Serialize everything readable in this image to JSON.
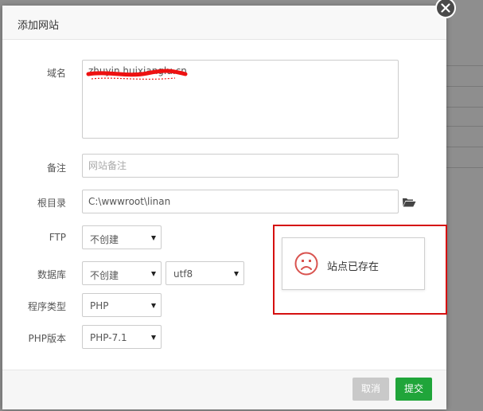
{
  "dialog": {
    "title": "添加网站"
  },
  "form": {
    "domain": {
      "label": "域名",
      "value": "zhuyin.huixianglu.cn"
    },
    "remark": {
      "label": "备注",
      "placeholder": "网站备注"
    },
    "root_dir": {
      "label": "根目录",
      "value": "C:\\wwwroot\\linan"
    },
    "ftp": {
      "label": "FTP",
      "selected": "不创建"
    },
    "database": {
      "label": "数据库",
      "selected": "不创建",
      "charset": "utf8"
    },
    "program_type": {
      "label": "程序类型",
      "selected": "PHP"
    },
    "php_version": {
      "label": "PHP版本",
      "selected": "PHP-7.1"
    }
  },
  "footer": {
    "cancel_label": "取消",
    "submit_label": "提交"
  },
  "toast": {
    "message": "站点已存在",
    "icon": "sad-face-icon",
    "color": "#d9534f"
  },
  "colors": {
    "submit": "#20a53a",
    "cancel": "#c9c9c9",
    "highlight": "#d51010"
  }
}
